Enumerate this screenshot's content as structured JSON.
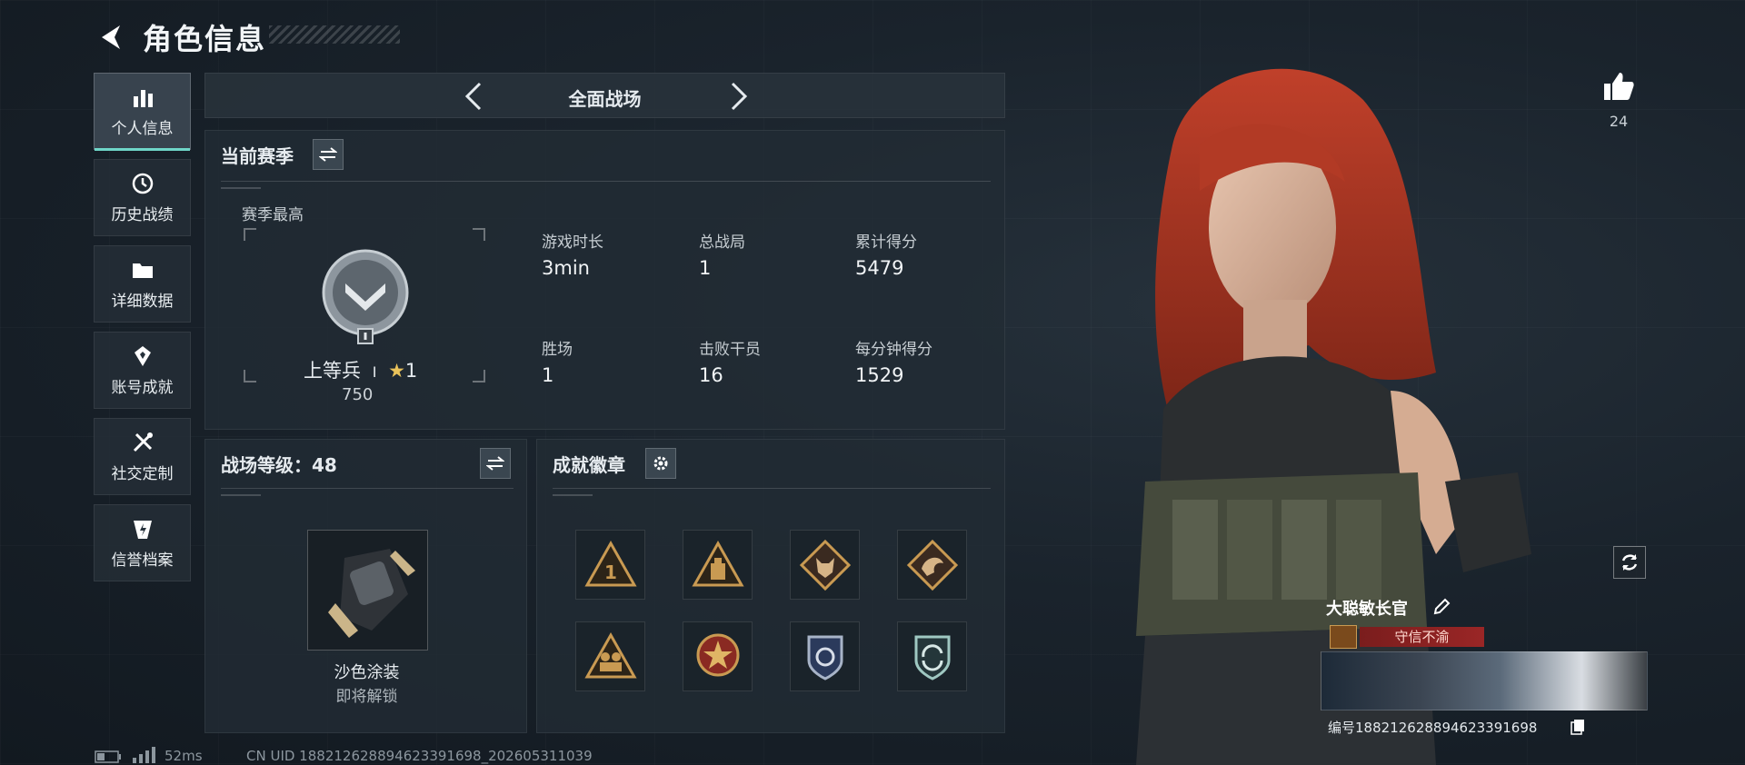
{
  "header": {
    "title": "角色信息"
  },
  "sidebar": {
    "items": [
      {
        "label": "个人信息",
        "icon": "bar-chart-icon",
        "active": true
      },
      {
        "label": "历史战绩",
        "icon": "clock-icon",
        "active": false
      },
      {
        "label": "详细数据",
        "icon": "folder-icon",
        "active": false
      },
      {
        "label": "账号成就",
        "icon": "medal-icon",
        "active": false
      },
      {
        "label": "社交定制",
        "icon": "tools-icon",
        "active": false
      },
      {
        "label": "信誉档案",
        "icon": "shield-bolt-icon",
        "active": false
      }
    ]
  },
  "mode": {
    "title": "全面战场"
  },
  "season": {
    "heading": "当前赛季",
    "best_label": "赛季最高",
    "rank_name": "上等兵",
    "rank_tier": "Ⅰ",
    "rank_stars": "1",
    "rank_points": "750",
    "stats": [
      {
        "label": "游戏时长",
        "value": "3min"
      },
      {
        "label": "总战局",
        "value": "1"
      },
      {
        "label": "累计得分",
        "value": "5479"
      },
      {
        "label": "胜场",
        "value": "1"
      },
      {
        "label": "击败干员",
        "value": "16"
      },
      {
        "label": "每分钟得分",
        "value": "1529"
      }
    ]
  },
  "battlefield_level": {
    "heading": "战场等级：48",
    "reward_name": "沙色涂装",
    "reward_status": "即将解锁"
  },
  "achievements": {
    "heading": "成就徽章",
    "badges": [
      "rank-one-badge-icon",
      "supply-badge-icon",
      "wolf-badge-icon",
      "dragon-badge-icon",
      "squad-badge-icon",
      "star-emblem-badge-icon",
      "police-shield-badge-icon",
      "cycle-shield-badge-icon"
    ]
  },
  "profile": {
    "likes": "24",
    "name": "大聪敏长官",
    "honor_title": "守信不渝",
    "id_label": "编号",
    "id_value": "18821262889462339169​8"
  },
  "status_bar": {
    "ping": "52ms",
    "uid_text": "CN UID 18821262889462339169​8_202605311039"
  },
  "colors": {
    "accent": "#6fd6c8",
    "badge_gold": "#c99a52",
    "honor_red": "#9a2626"
  }
}
